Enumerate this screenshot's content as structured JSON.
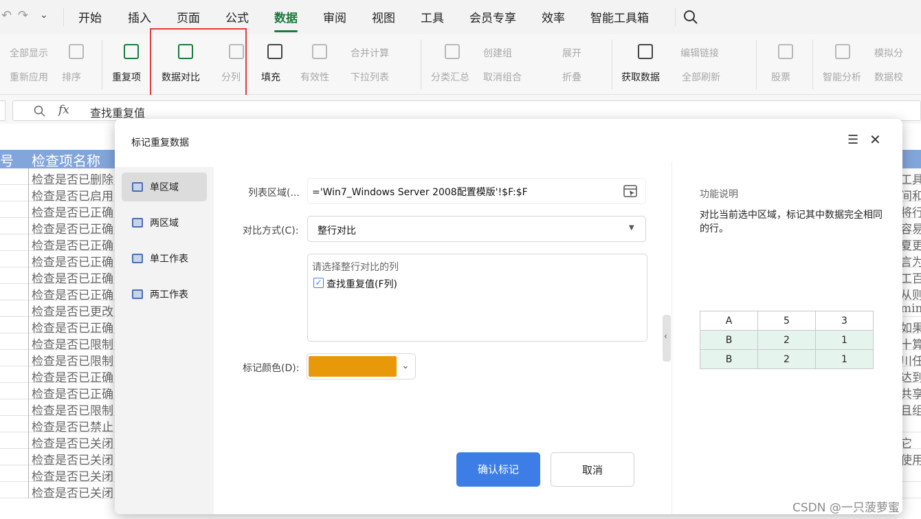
{
  "menu": {
    "tabs": [
      {
        "label": "开始"
      },
      {
        "label": "插入"
      },
      {
        "label": "页面"
      },
      {
        "label": "公式"
      },
      {
        "label": "数据"
      },
      {
        "label": "审阅"
      },
      {
        "label": "视图"
      },
      {
        "label": "工具"
      },
      {
        "label": "会员专享"
      },
      {
        "label": "效率"
      },
      {
        "label": "智能工具箱"
      }
    ],
    "active": "数据"
  },
  "ribbon": {
    "show_all": "全部显示",
    "reapply": "重新应用",
    "sort": "排序",
    "duplicates": "重复项",
    "data_compare": "数据对比",
    "split_column": "分列",
    "fill": "填充",
    "validity": "有效性",
    "merge_calc": "合并计算",
    "dropdown_list": "下拉列表",
    "subtotal": "分类汇总",
    "create_group": "创建组",
    "ungroup": "取消组合",
    "expand": "展开",
    "collapse": "折叠",
    "get_data": "获取数据",
    "edit_links": "编辑链接",
    "refresh_all": "全部刷新",
    "stocks": "股票",
    "smart_analysis": "智能分析",
    "simulate": "模拟分",
    "data_check": "数据校"
  },
  "formula_bar": {
    "fx": "fx",
    "content": "查找重复值"
  },
  "sheet": {
    "header_a": "号",
    "header_b": "检查项名称",
    "rows": [
      {
        "b": "检查是否已删除",
        "r": "工具"
      },
      {
        "b": "检查是否已启用",
        "r": "间和"
      },
      {
        "b": "检查是否已正确",
        "r": "将行"
      },
      {
        "b": "检查是否已正确",
        "r": "容易"
      },
      {
        "b": "检查是否已正确",
        "r": "夏更"
      },
      {
        "b": "检查是否已正确",
        "r": "言为。"
      },
      {
        "b": "检查是否已正确",
        "r": "工百八"
      },
      {
        "b": "检查是否已正确",
        "r": "从则"
      },
      {
        "b": "检查是否已更改",
        "r": "mini"
      },
      {
        "b": "检查是否已正确",
        "r": "如果"
      },
      {
        "b": "检查是否已限制",
        "r": "十算机"
      },
      {
        "b": "检查是否已限制",
        "r": "川任何"
      },
      {
        "b": "检查是否已正确",
        "r": "达到说"
      },
      {
        "b": "检查是否已正确",
        "r": "共享"
      },
      {
        "b": "检查是否已限制",
        "r": "且组。"
      },
      {
        "b": "检查是否已禁止",
        "r": ""
      },
      {
        "b": "检查是否已关闭",
        "r": "它"
      },
      {
        "b": "检查是否已关闭",
        "r": "使用"
      },
      {
        "b": "检查是否已关闭",
        "r": ""
      },
      {
        "b": "检查是否已关闭",
        "r": ""
      }
    ]
  },
  "dialog": {
    "title": "标记重复数据",
    "side_items": [
      {
        "label": "单区域"
      },
      {
        "label": "两区域"
      },
      {
        "label": "单工作表"
      },
      {
        "label": "两工作表"
      }
    ],
    "range_label": "列表区域(...",
    "range_value": "='Win7_Windows Server 2008配置模版'!$F:$F",
    "compare_label": "对比方式(C):",
    "compare_value": "整行对比",
    "columns_hint": "请选择整行对比的列",
    "column_option": "查找重复值(F列)",
    "column_checked": true,
    "color_label": "标记颜色(D):",
    "mark_color": "#E8990A",
    "ok_button": "确认标记",
    "cancel_button": "取消",
    "help_title": "功能说明",
    "help_text": "对比当前选中区域，标记其中数据完全相同的行。",
    "demo_table": [
      [
        "A",
        "5",
        "3"
      ],
      [
        "B",
        "2",
        "1"
      ],
      [
        "B",
        "2",
        "1"
      ]
    ]
  },
  "watermark": "CSDN @一只菠萝蜜",
  "colors": {
    "accent_green": "#1A7A3C",
    "header_blue": "#3F76C8",
    "highlight_red": "#E43B3B",
    "primary_button": "#3D7EE6"
  }
}
